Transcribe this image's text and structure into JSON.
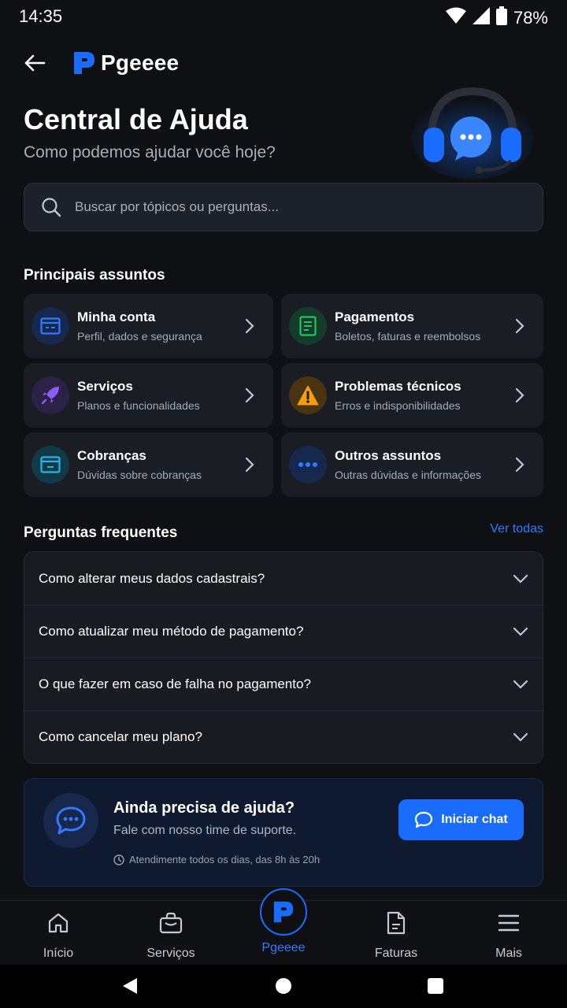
{
  "status_bar": {
    "time": "14:35",
    "battery_pct": "78%"
  },
  "header": {
    "brand": "Pgeeee"
  },
  "hero": {
    "title": "Central de Ajuda",
    "subtitle": "Como podemos ajudar você hoje?"
  },
  "search": {
    "placeholder": "Buscar por tópicos ou perguntas..."
  },
  "topics": {
    "title": "Principais assuntos",
    "items": [
      {
        "title": "Minha conta",
        "desc": "Perfil, dados e segurança",
        "icon": "account-card-icon",
        "color": "#2f7bff"
      },
      {
        "title": "Pagamentos",
        "desc": "Boletos, faturas e reembolsos",
        "icon": "receipt-icon",
        "color": "#22c55e"
      },
      {
        "title": "Serviços",
        "desc": "Planos e funcionalidades",
        "icon": "rocket-icon",
        "color": "#8b5cf6"
      },
      {
        "title": "Problemas técnicos",
        "desc": "Erros e indisponibilidades",
        "icon": "warning-icon",
        "color": "#f59e0b"
      },
      {
        "title": "Cobranças",
        "desc": "Dúvidas sobre cobranças",
        "icon": "billing-card-icon",
        "color": "#22b8e6"
      },
      {
        "title": "Outros assuntos",
        "desc": "Outras dúvidas e informações",
        "icon": "more-dots-icon",
        "color": "#2f7bff"
      }
    ]
  },
  "faq": {
    "title": "Perguntas frequentes",
    "see_all": "Ver todas",
    "items": [
      "Como alterar meus dados cadastrais?",
      "Como atualizar meu método de pagamento?",
      "O que fazer em caso de falha no pagamento?",
      "Como cancelar meu plano?"
    ]
  },
  "help": {
    "title": "Ainda precisa de ajuda?",
    "subtitle": "Fale com nosso time de suporte.",
    "hours": "Atendimente todos os dias, das 8h às 20h",
    "button": "Iniciar chat"
  },
  "bottom_nav": {
    "items": [
      {
        "label": "Início",
        "icon": "home-icon"
      },
      {
        "label": "Serviços",
        "icon": "bag-icon"
      },
      {
        "label": "Pgeeee",
        "icon": "brand-icon"
      },
      {
        "label": "Faturas",
        "icon": "document-icon"
      },
      {
        "label": "Mais",
        "icon": "menu-icon"
      }
    ],
    "accent": "#1a6cff"
  }
}
